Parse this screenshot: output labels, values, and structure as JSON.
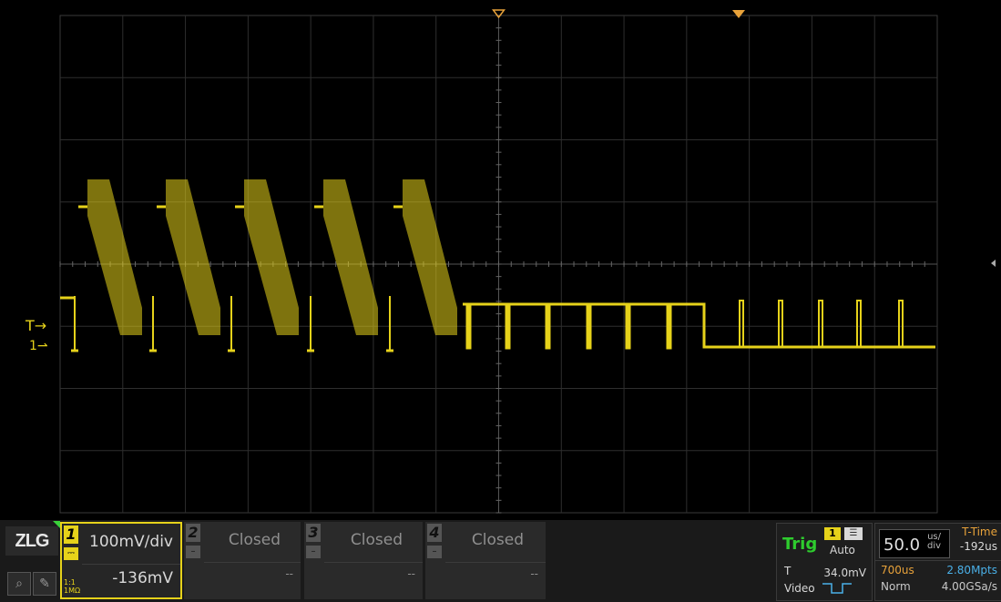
{
  "brand": "ZLG",
  "colors": {
    "ch1": "#e6d21a",
    "grid": "#2e2e2e",
    "trig_ok": "#2ecc2e",
    "orange": "#e8a23a",
    "blue": "#4ab0e8"
  },
  "screen_markers": {
    "trigger_level_label": "T",
    "ch1_marker_label": "1"
  },
  "channels": [
    {
      "number": "1",
      "scale": "100mV/div",
      "offset": "-136mV",
      "probe": "1:1",
      "impedance": "1MΩ",
      "coupling_icon": "dc-coupling-icon"
    },
    {
      "number": "2",
      "scale": "Closed",
      "offset": "--"
    },
    {
      "number": "3",
      "scale": "Closed",
      "offset": "--"
    },
    {
      "number": "4",
      "scale": "Closed",
      "offset": "--"
    }
  ],
  "trigger": {
    "status": "Trig",
    "source": "1",
    "mode": "Auto",
    "level_label": "T",
    "level": "34.0mV",
    "type": "Video"
  },
  "timebase": {
    "scale": "50.0",
    "unit_top": "us/",
    "unit_bottom": "div",
    "ttime_label": "T-Time",
    "ttime": "-192us",
    "acq_time": "700us",
    "memory": "2.80Mpts",
    "acq_mode": "Norm",
    "sample_rate": "4.00GSa/s"
  },
  "waveform": {
    "channel": "1",
    "description_values": {
      "bursts": 5,
      "pulses_after_bursts": 9
    }
  },
  "tools": [
    "zoom-tool-icon",
    "probe-tool-icon"
  ]
}
